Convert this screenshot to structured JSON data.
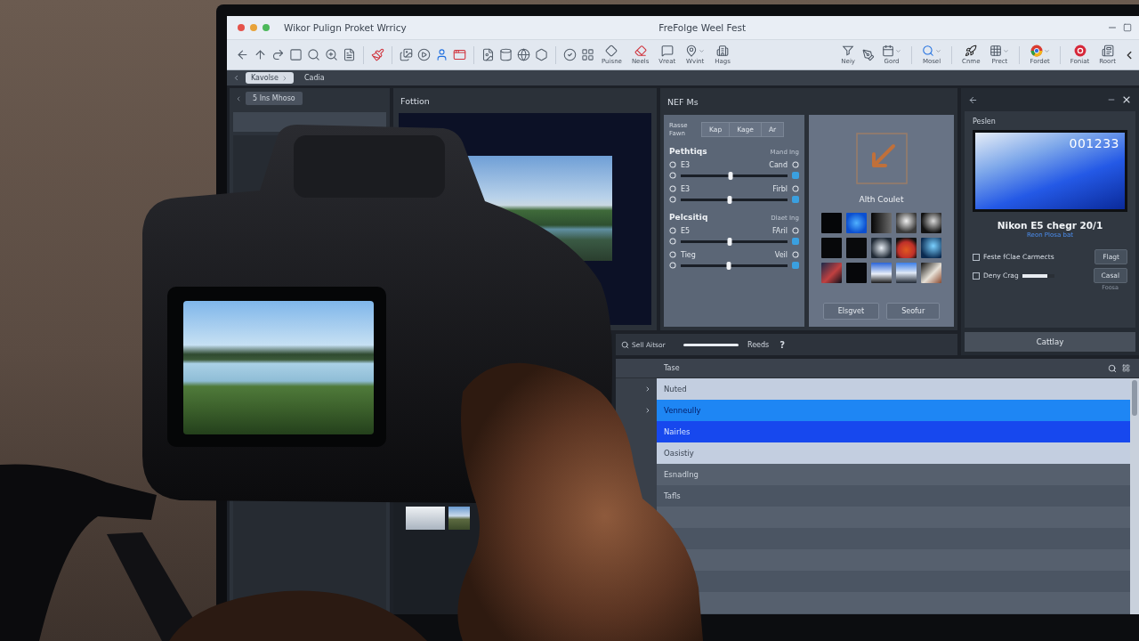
{
  "window": {
    "title": "Wikor Pulign Proket Wrricy",
    "document_title": "FreFolge Weel Fest"
  },
  "toolbar": {
    "left_tools": [
      {
        "label": "Puisne",
        "dropdown": false
      },
      {
        "label": "Neels",
        "dropdown": false
      },
      {
        "label": "Vreat",
        "dropdown": false
      },
      {
        "label": "Wvint",
        "dropdown": true
      },
      {
        "label": "Hags",
        "dropdown": false
      }
    ],
    "right_tools": [
      {
        "label": "Neiy",
        "dropdown": false
      },
      {
        "label": "Gord",
        "dropdown": true
      },
      {
        "label": "Mosel",
        "dropdown": true
      },
      {
        "label": "Cnme",
        "dropdown": false
      },
      {
        "label": "Prect",
        "dropdown": true
      },
      {
        "label": "Fordet",
        "dropdown": true
      },
      {
        "label": "Foniat",
        "dropdown": false
      },
      {
        "label": "Roort",
        "dropdown": false
      }
    ]
  },
  "tabs": [
    {
      "label": "Kavolse",
      "selected": true
    },
    {
      "label": "Cadia",
      "selected": false
    }
  ],
  "left_panel": {
    "button": "5 Ins Mhoso"
  },
  "preview_panel": {
    "title": "Fottion"
  },
  "nef_panel": {
    "title": "NEF Ms",
    "mode_label": "Rasse Fawn",
    "modes": [
      "Kap",
      "Kage",
      "Ar"
    ],
    "sections": [
      {
        "title": "Pethtiqs",
        "caption": "Mand Ing",
        "sliders": [
          {
            "label": "E3",
            "value": "Cand",
            "level": 0.47
          },
          {
            "label": "E3",
            "value": "Firbl",
            "level": 0.46
          }
        ]
      },
      {
        "title": "Pelcsitiq",
        "caption": "Dlaet Ing",
        "sliders": [
          {
            "label": "E5",
            "value": "FAril",
            "level": 0.46
          },
          {
            "label": "Tieg",
            "value": "Veil",
            "level": 0.45
          }
        ]
      }
    ]
  },
  "gallery": {
    "title": "Alth Coulet",
    "buttons": [
      "Elsgvet",
      "Seofur"
    ]
  },
  "detail_panel": {
    "title": "Peslen",
    "timecode": "001233",
    "name": "Nikon E5 chegr 20/1",
    "subtitle": "Reon Plosa bat",
    "options": [
      {
        "kind": "checkbox",
        "label": "Feste fClae Carmects",
        "checked": false,
        "button": "Flagt"
      },
      {
        "kind": "slider",
        "label": "Deny Crag",
        "checked": false,
        "level": 0.8,
        "button": "Casal"
      }
    ],
    "note": "Foosa",
    "footer_button": "Cattlay"
  },
  "search_bar": {
    "placeholder": "Sell Aitsor",
    "button": "Reeds",
    "help": "?"
  },
  "table": {
    "columns": [
      "Tase"
    ],
    "rows": [
      {
        "name": "Nuted",
        "selected": false,
        "focused": false,
        "highlighted": true,
        "expandable": true
      },
      {
        "name": "Venneully",
        "selected": true,
        "focused": true,
        "highlighted": false,
        "expandable": true
      },
      {
        "name": "Nairles",
        "selected": true,
        "focused": false,
        "highlighted": false,
        "expandable": false
      },
      {
        "name": "Oasistiy",
        "selected": false,
        "focused": false,
        "highlighted": true,
        "expandable": false
      },
      {
        "name": "Esnadlng",
        "selected": false,
        "focused": false,
        "highlighted": false,
        "expandable": false
      },
      {
        "name": "Tafls",
        "selected": false,
        "focused": false,
        "highlighted": false,
        "expandable": false
      }
    ]
  }
}
